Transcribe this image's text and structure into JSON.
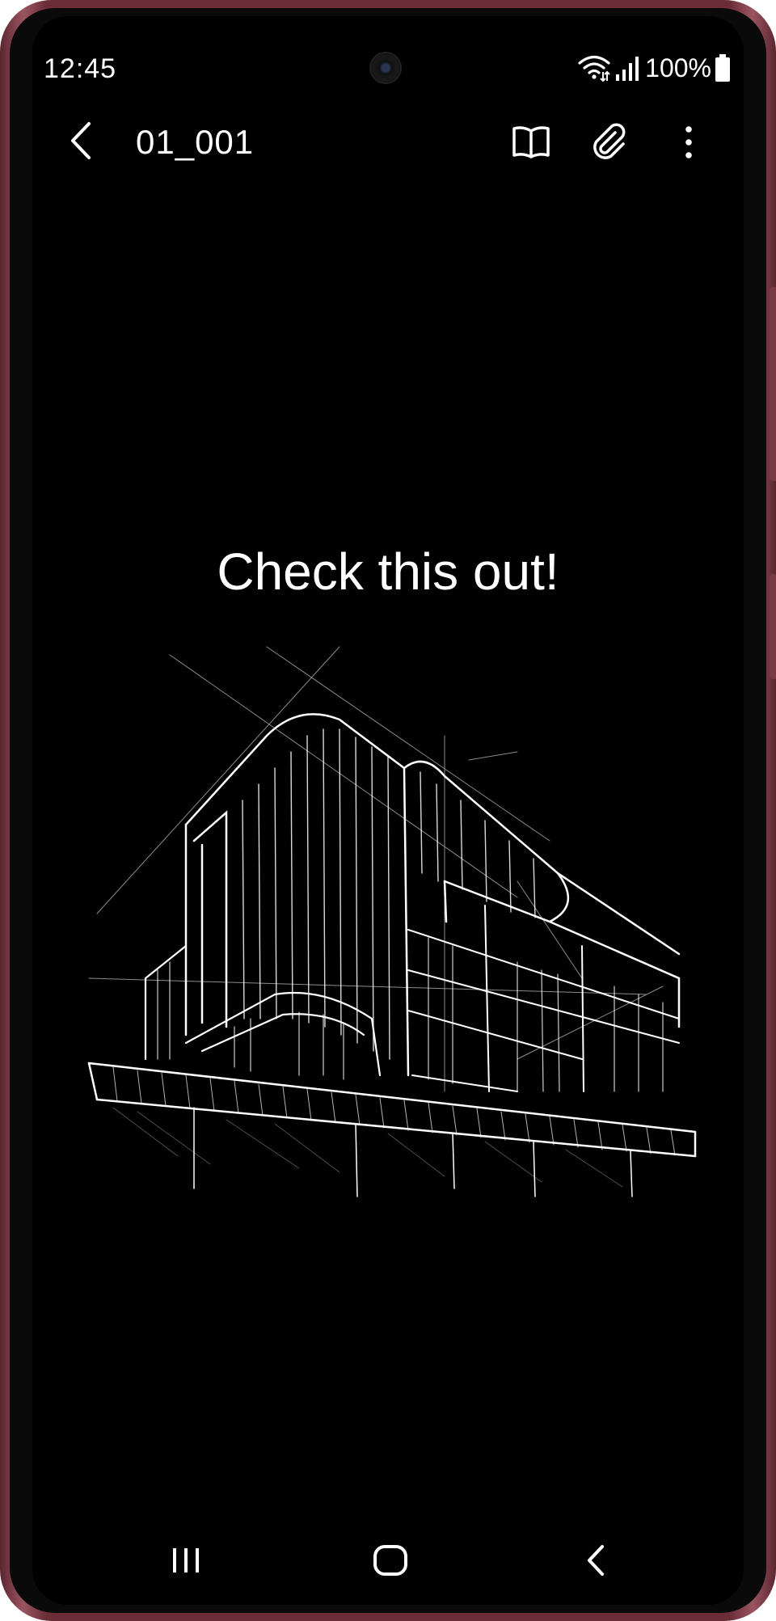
{
  "status_bar": {
    "time": "12:45",
    "battery": "100%",
    "icons": [
      "wifi-icon",
      "signal-icon",
      "battery-icon"
    ]
  },
  "toolbar": {
    "title": "01_001",
    "icons": [
      "back-arrow-icon",
      "reading-mode-icon",
      "paperclip-icon",
      "more-options-icon"
    ]
  },
  "note": {
    "text": "Check this out!",
    "drawing": "building-sketch"
  },
  "nav_bar": {
    "icons": [
      "recents-icon",
      "home-icon",
      "back-icon"
    ]
  },
  "colors": {
    "background": "#000000",
    "foreground": "#ffffff",
    "frame": "#6a2d38"
  }
}
